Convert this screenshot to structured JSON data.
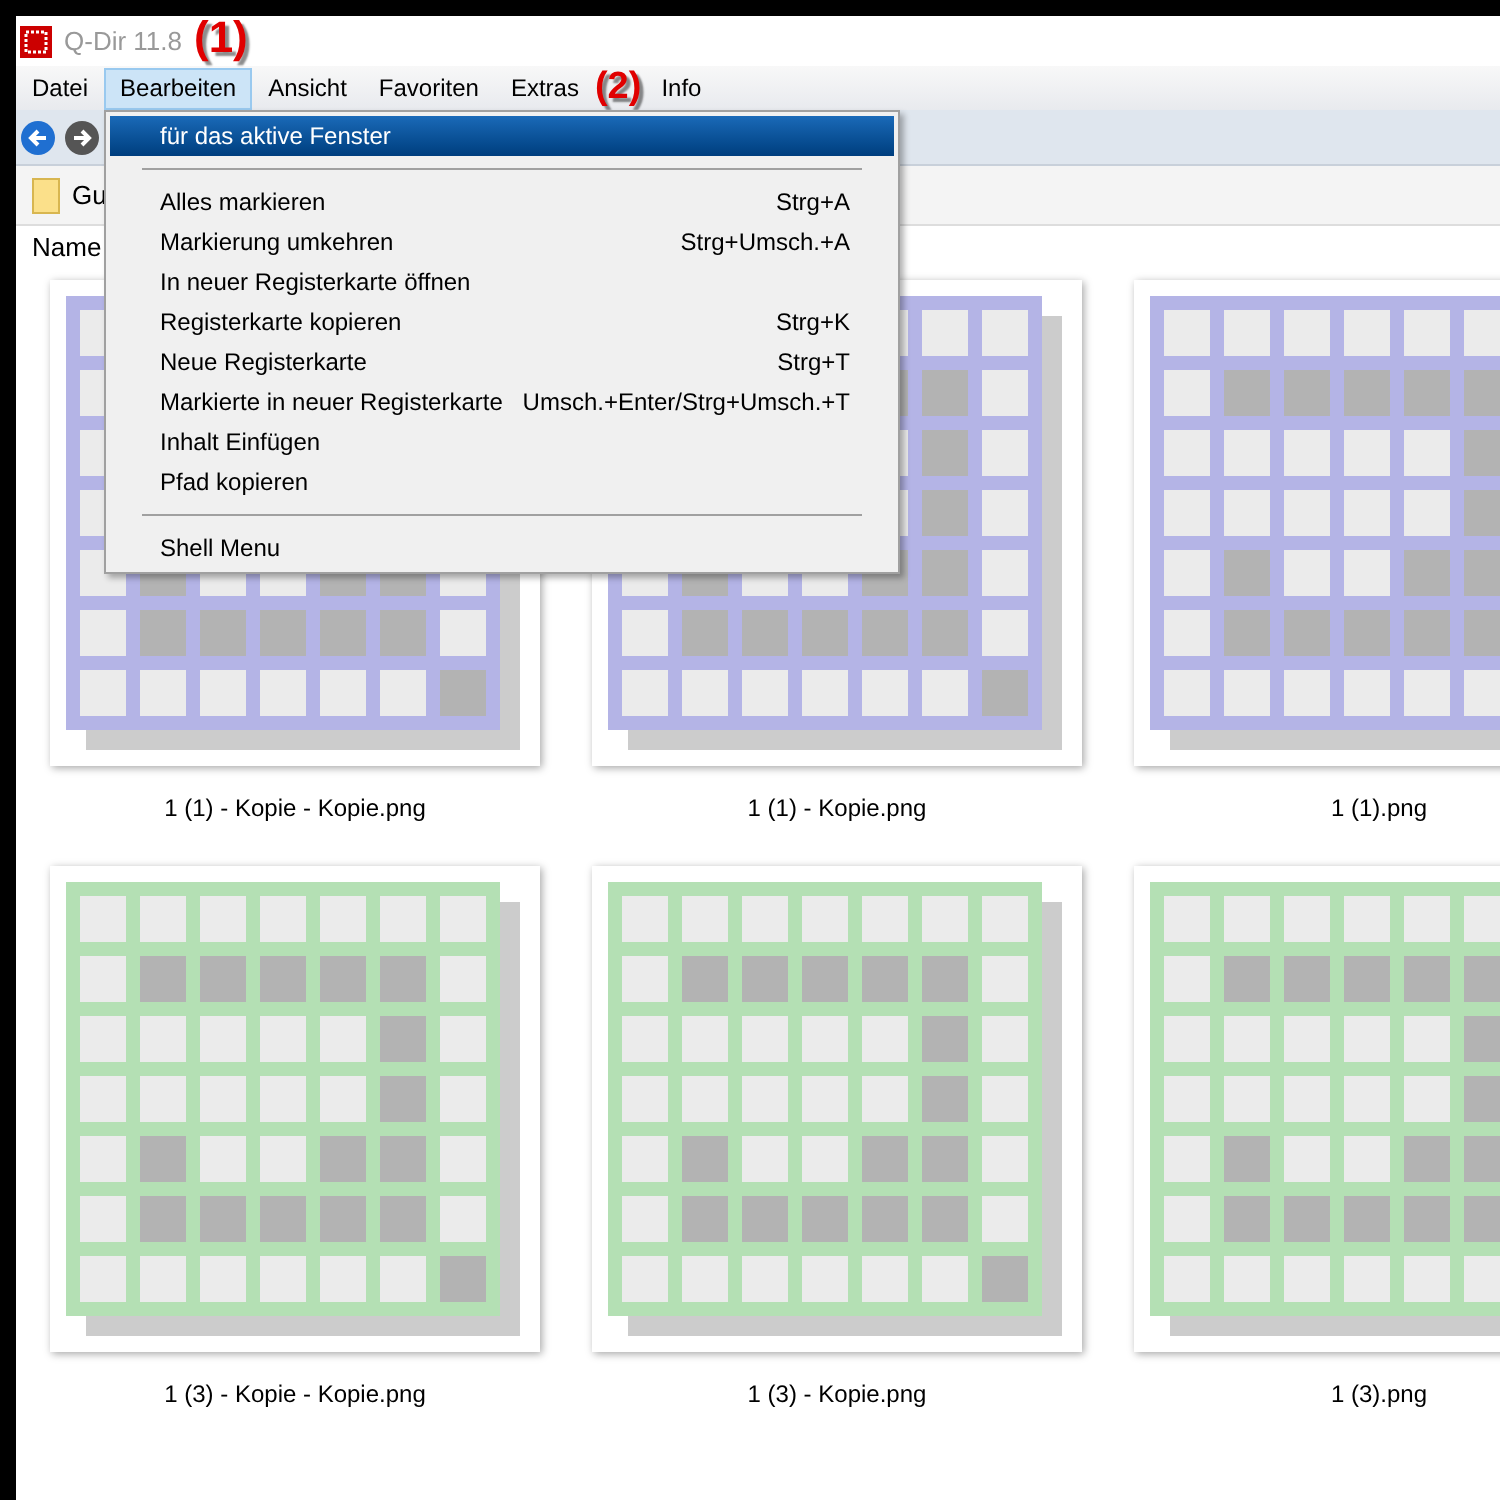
{
  "window": {
    "title": "Q-Dir 11.8"
  },
  "annotations": [
    {
      "label": "(1)"
    },
    {
      "label": "(2)"
    }
  ],
  "menu_bar": [
    {
      "label": "Datei",
      "selected": false
    },
    {
      "label": "Bearbeiten",
      "selected": true
    },
    {
      "label": "Ansicht",
      "selected": false
    },
    {
      "label": "Favoriten",
      "selected": false
    },
    {
      "label": "Extras",
      "selected": false
    },
    {
      "label": "Info",
      "selected": false
    }
  ],
  "dropdown": [
    {
      "kind": "item",
      "label": "für das aktive Fenster",
      "selected": true
    },
    {
      "kind": "separator"
    },
    {
      "kind": "item",
      "label": "Alles markieren",
      "shortcut": "Strg+A",
      "selected": false
    },
    {
      "kind": "item",
      "label": "Markierung umkehren",
      "shortcut": "Strg+Umsch.+A",
      "selected": false
    },
    {
      "kind": "item",
      "label": "In neuer Registerkarte öffnen",
      "selected": false
    },
    {
      "kind": "item",
      "label": "Registerkarte kopieren",
      "shortcut": "Strg+K",
      "selected": false
    },
    {
      "kind": "item",
      "label": "Neue Registerkarte",
      "shortcut": "Strg+T",
      "selected": false
    },
    {
      "kind": "item",
      "label": "Markierte in neuer Registerkarte",
      "shortcut": "Umsch.+Enter/Strg+Umsch.+T",
      "selected": false
    },
    {
      "kind": "item",
      "label": "Inhalt Einfügen",
      "selected": false
    },
    {
      "kind": "item",
      "label": "Pfad kopieren",
      "selected": false
    },
    {
      "kind": "separator"
    },
    {
      "kind": "item",
      "label": "Shell Menu",
      "selected": false
    }
  ],
  "address_bar": {
    "text": "Gu"
  },
  "column_header": {
    "label": "Name"
  },
  "files": [
    {
      "name": "1 (1) - Kopie - Kopie.png",
      "color": "#b4b4e6"
    },
    {
      "name": "1 (1) - Kopie.png",
      "color": "#b4b4e6"
    },
    {
      "name": "1 (1).png",
      "color": "#b4b4e6"
    },
    {
      "name": "1 (3) - Kopie - Kopie.png",
      "color": "#b4e0b4"
    },
    {
      "name": "1 (3) - Kopie.png",
      "color": "#b4e0b4"
    },
    {
      "name": "1 (3).png",
      "color": "#b4e0b4"
    }
  ]
}
